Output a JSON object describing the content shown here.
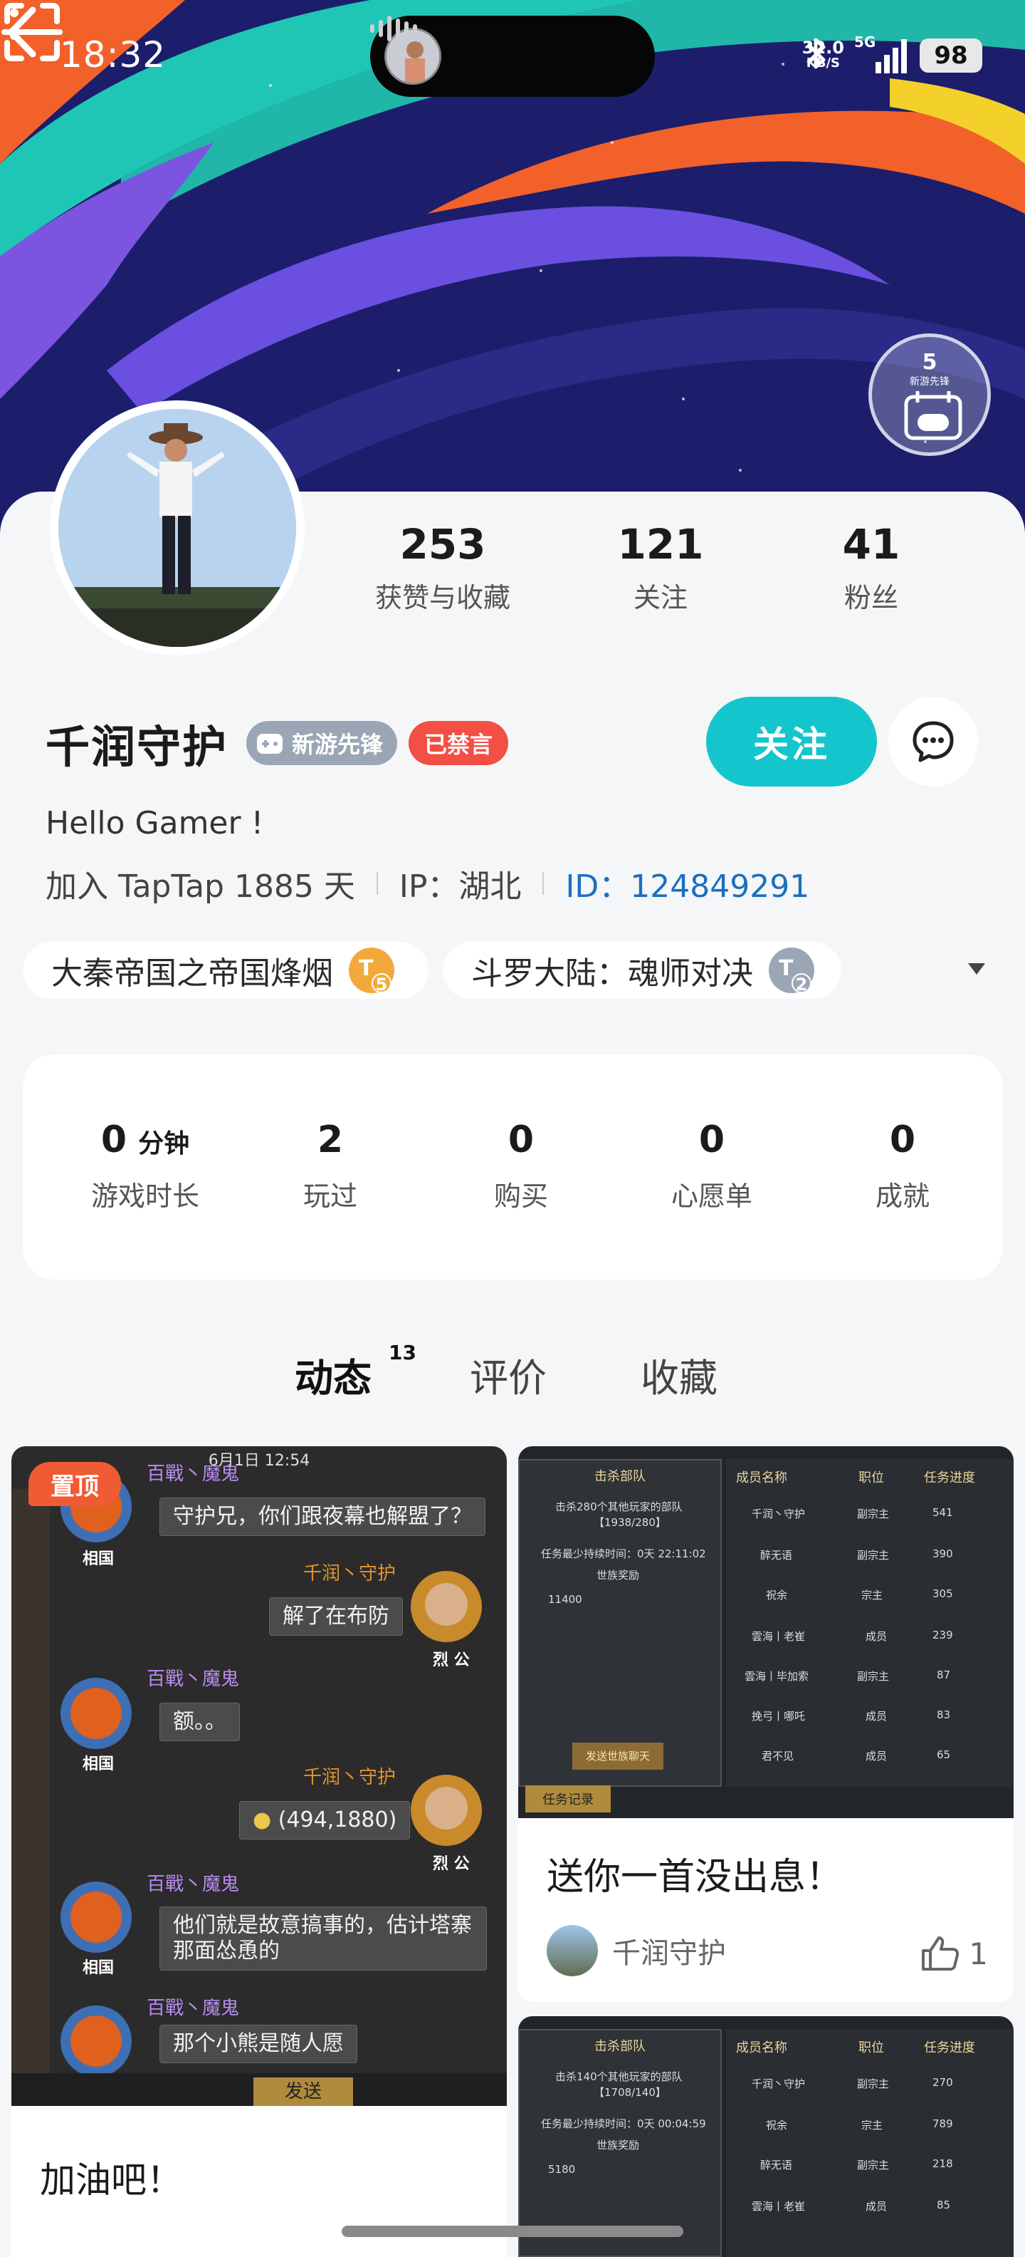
{
  "status": {
    "time": "18:32",
    "speed_value": "32.0",
    "speed_unit": "KB/S",
    "network": "5G",
    "battery": "98"
  },
  "header_badge": {
    "level": "5",
    "label": "新游先锋"
  },
  "profile": {
    "stats": [
      {
        "value": "253",
        "label": "获赞与收藏"
      },
      {
        "value": "121",
        "label": "关注"
      },
      {
        "value": "41",
        "label": "粉丝"
      }
    ],
    "name": "千润守护",
    "tag_new": "新游先锋",
    "tag_banned": "已禁言",
    "follow_label": "关注",
    "bio": "Hello Gamer !",
    "joined": "加入 TapTap 1885 天",
    "ip": "IP：湖北",
    "id": "ID：124849291"
  },
  "games": [
    {
      "name": "大秦帝国之帝国烽烟",
      "level": "5",
      "color": "#f2a93b"
    },
    {
      "name": "斗罗大陆：魂师对决",
      "level": "2",
      "color": "#9aa6b6"
    }
  ],
  "game_stats": [
    {
      "value": "0",
      "unit": "分钟",
      "label": "游戏时长"
    },
    {
      "value": "2",
      "unit": "",
      "label": "玩过"
    },
    {
      "value": "0",
      "unit": "",
      "label": "购买"
    },
    {
      "value": "0",
      "unit": "",
      "label": "心愿单"
    },
    {
      "value": "0",
      "unit": "",
      "label": "成就"
    }
  ],
  "tabs": [
    {
      "label": "动态",
      "count": "13"
    },
    {
      "label": "评价"
    },
    {
      "label": "收藏"
    }
  ],
  "feed": {
    "left": {
      "pinned": "置顶",
      "title": "加油吧！",
      "chat": {
        "date": "6月1日 12:54",
        "sender_a": "百戰丶魔鬼",
        "sender_b": "千润丶守护",
        "rank_a": "相国",
        "rank_b": "烈 公",
        "messages": [
          "守护兄，你们跟夜幕也解盟了？",
          "解了在布防",
          "额。。",
          "(494,1880)",
          "他们就是故意搞事的，估计塔寨那面怂恿的",
          "那个小熊是随人愿"
        ],
        "send_label": "发送"
      }
    },
    "right": {
      "title": "送你一首没出息！",
      "author": "千润守护",
      "likes": "1",
      "shot": {
        "panel_title": "击杀部队",
        "panel_line1": "击杀280个其他玩家的部队",
        "panel_line2": "【1938/280】",
        "panel_line3": "任务最少持续时间：0天 22:11:02",
        "panel_line4": "世族奖励",
        "panel_reward": "11400",
        "panel_button": "发送世族聊天",
        "records": "任务记录",
        "headers": [
          "成员名称",
          "职位",
          "任务进度"
        ],
        "rows": [
          [
            "千润丶守护",
            "副宗主",
            "541"
          ],
          [
            "醉无语",
            "副宗主",
            "390"
          ],
          [
            "祝余",
            "宗主",
            "305"
          ],
          [
            "雲海丨老崔",
            "成员",
            "239"
          ],
          [
            "雲海丨毕加索",
            "副宗主",
            "87"
          ],
          [
            "挽弓丨哪吒",
            "成员",
            "83"
          ],
          [
            "君不见",
            "成员",
            "65"
          ]
        ]
      }
    },
    "right2": {
      "shot": {
        "panel_title": "击杀部队",
        "panel_line1": "击杀140个其他玩家的部队",
        "panel_line2": "【1708/140】",
        "panel_line3": "任务最少持续时间：0天 00:04:59",
        "panel_line4": "世族奖励",
        "panel_reward": "5180",
        "headers": [
          "成员名称",
          "职位",
          "任务进度"
        ],
        "rows": [
          [
            "千润丶守护",
            "副宗主",
            "270"
          ],
          [
            "祝余",
            "宗主",
            "789"
          ],
          [
            "醉无语",
            "副宗主",
            "218"
          ],
          [
            "雲海丨老崔",
            "成员",
            "85"
          ]
        ]
      }
    }
  },
  "colors": {
    "accent": "#15c5ce",
    "banned": "#f24f45",
    "pinned": "#f05a34",
    "id_link": "#1b6fbf"
  }
}
